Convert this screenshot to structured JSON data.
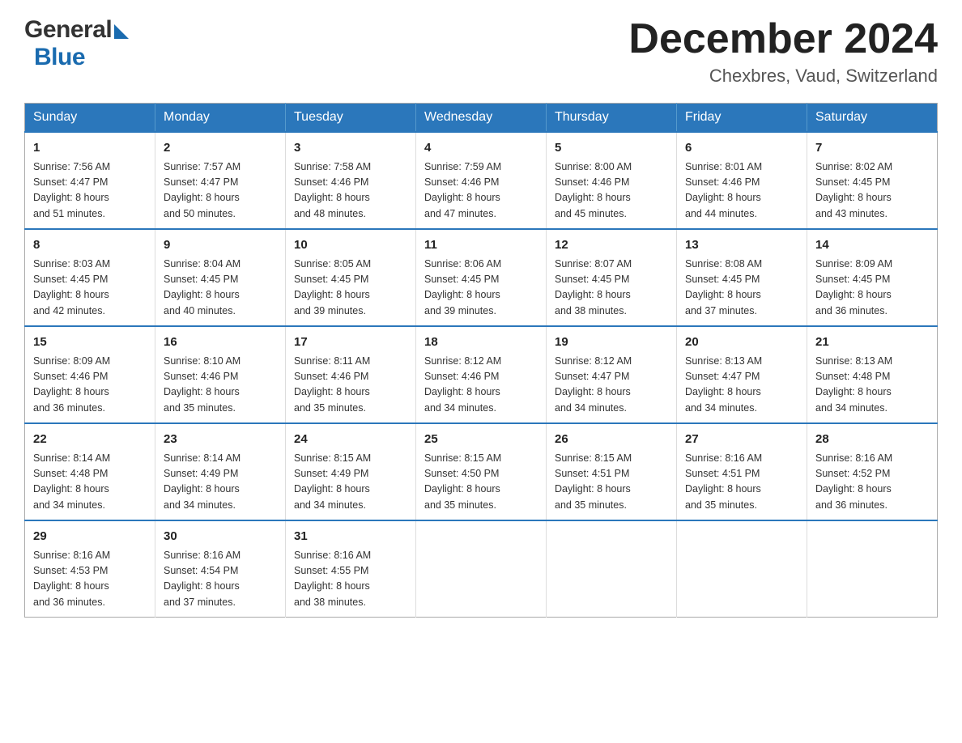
{
  "header": {
    "logo_general": "General",
    "logo_blue": "Blue",
    "title": "December 2024",
    "subtitle": "Chexbres, Vaud, Switzerland"
  },
  "weekdays": [
    "Sunday",
    "Monday",
    "Tuesday",
    "Wednesday",
    "Thursday",
    "Friday",
    "Saturday"
  ],
  "weeks": [
    [
      {
        "day": "1",
        "info": "Sunrise: 7:56 AM\nSunset: 4:47 PM\nDaylight: 8 hours\nand 51 minutes."
      },
      {
        "day": "2",
        "info": "Sunrise: 7:57 AM\nSunset: 4:47 PM\nDaylight: 8 hours\nand 50 minutes."
      },
      {
        "day": "3",
        "info": "Sunrise: 7:58 AM\nSunset: 4:46 PM\nDaylight: 8 hours\nand 48 minutes."
      },
      {
        "day": "4",
        "info": "Sunrise: 7:59 AM\nSunset: 4:46 PM\nDaylight: 8 hours\nand 47 minutes."
      },
      {
        "day": "5",
        "info": "Sunrise: 8:00 AM\nSunset: 4:46 PM\nDaylight: 8 hours\nand 45 minutes."
      },
      {
        "day": "6",
        "info": "Sunrise: 8:01 AM\nSunset: 4:46 PM\nDaylight: 8 hours\nand 44 minutes."
      },
      {
        "day": "7",
        "info": "Sunrise: 8:02 AM\nSunset: 4:45 PM\nDaylight: 8 hours\nand 43 minutes."
      }
    ],
    [
      {
        "day": "8",
        "info": "Sunrise: 8:03 AM\nSunset: 4:45 PM\nDaylight: 8 hours\nand 42 minutes."
      },
      {
        "day": "9",
        "info": "Sunrise: 8:04 AM\nSunset: 4:45 PM\nDaylight: 8 hours\nand 40 minutes."
      },
      {
        "day": "10",
        "info": "Sunrise: 8:05 AM\nSunset: 4:45 PM\nDaylight: 8 hours\nand 39 minutes."
      },
      {
        "day": "11",
        "info": "Sunrise: 8:06 AM\nSunset: 4:45 PM\nDaylight: 8 hours\nand 39 minutes."
      },
      {
        "day": "12",
        "info": "Sunrise: 8:07 AM\nSunset: 4:45 PM\nDaylight: 8 hours\nand 38 minutes."
      },
      {
        "day": "13",
        "info": "Sunrise: 8:08 AM\nSunset: 4:45 PM\nDaylight: 8 hours\nand 37 minutes."
      },
      {
        "day": "14",
        "info": "Sunrise: 8:09 AM\nSunset: 4:45 PM\nDaylight: 8 hours\nand 36 minutes."
      }
    ],
    [
      {
        "day": "15",
        "info": "Sunrise: 8:09 AM\nSunset: 4:46 PM\nDaylight: 8 hours\nand 36 minutes."
      },
      {
        "day": "16",
        "info": "Sunrise: 8:10 AM\nSunset: 4:46 PM\nDaylight: 8 hours\nand 35 minutes."
      },
      {
        "day": "17",
        "info": "Sunrise: 8:11 AM\nSunset: 4:46 PM\nDaylight: 8 hours\nand 35 minutes."
      },
      {
        "day": "18",
        "info": "Sunrise: 8:12 AM\nSunset: 4:46 PM\nDaylight: 8 hours\nand 34 minutes."
      },
      {
        "day": "19",
        "info": "Sunrise: 8:12 AM\nSunset: 4:47 PM\nDaylight: 8 hours\nand 34 minutes."
      },
      {
        "day": "20",
        "info": "Sunrise: 8:13 AM\nSunset: 4:47 PM\nDaylight: 8 hours\nand 34 minutes."
      },
      {
        "day": "21",
        "info": "Sunrise: 8:13 AM\nSunset: 4:48 PM\nDaylight: 8 hours\nand 34 minutes."
      }
    ],
    [
      {
        "day": "22",
        "info": "Sunrise: 8:14 AM\nSunset: 4:48 PM\nDaylight: 8 hours\nand 34 minutes."
      },
      {
        "day": "23",
        "info": "Sunrise: 8:14 AM\nSunset: 4:49 PM\nDaylight: 8 hours\nand 34 minutes."
      },
      {
        "day": "24",
        "info": "Sunrise: 8:15 AM\nSunset: 4:49 PM\nDaylight: 8 hours\nand 34 minutes."
      },
      {
        "day": "25",
        "info": "Sunrise: 8:15 AM\nSunset: 4:50 PM\nDaylight: 8 hours\nand 35 minutes."
      },
      {
        "day": "26",
        "info": "Sunrise: 8:15 AM\nSunset: 4:51 PM\nDaylight: 8 hours\nand 35 minutes."
      },
      {
        "day": "27",
        "info": "Sunrise: 8:16 AM\nSunset: 4:51 PM\nDaylight: 8 hours\nand 35 minutes."
      },
      {
        "day": "28",
        "info": "Sunrise: 8:16 AM\nSunset: 4:52 PM\nDaylight: 8 hours\nand 36 minutes."
      }
    ],
    [
      {
        "day": "29",
        "info": "Sunrise: 8:16 AM\nSunset: 4:53 PM\nDaylight: 8 hours\nand 36 minutes."
      },
      {
        "day": "30",
        "info": "Sunrise: 8:16 AM\nSunset: 4:54 PM\nDaylight: 8 hours\nand 37 minutes."
      },
      {
        "day": "31",
        "info": "Sunrise: 8:16 AM\nSunset: 4:55 PM\nDaylight: 8 hours\nand 38 minutes."
      },
      {
        "day": "",
        "info": ""
      },
      {
        "day": "",
        "info": ""
      },
      {
        "day": "",
        "info": ""
      },
      {
        "day": "",
        "info": ""
      }
    ]
  ]
}
